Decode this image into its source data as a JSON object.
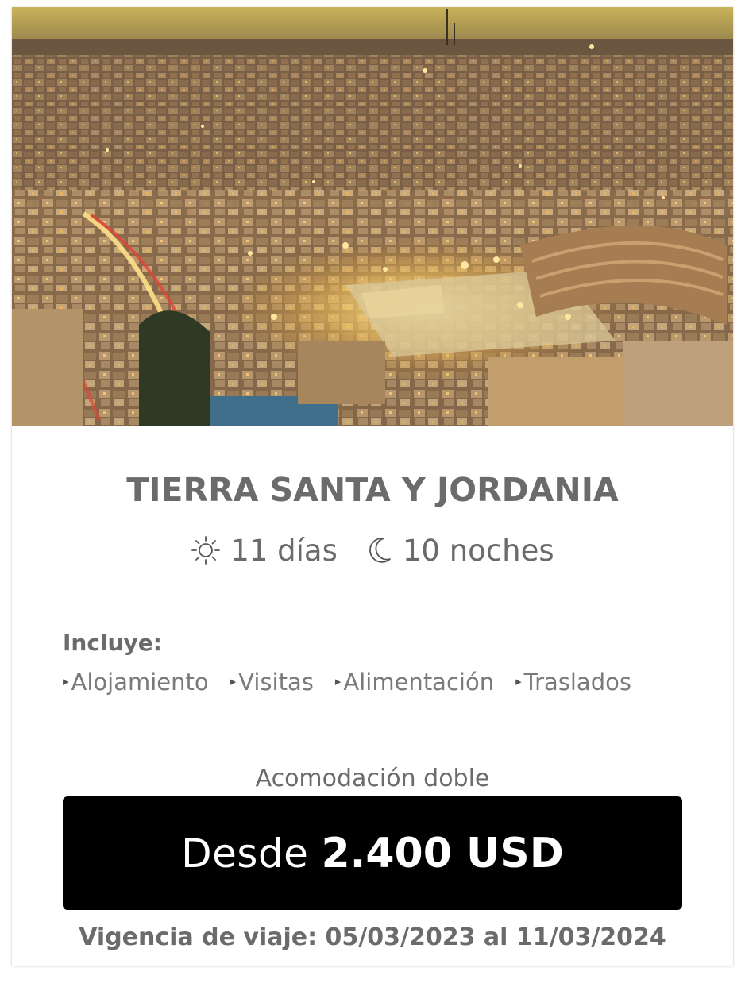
{
  "tour": {
    "image_alt": "Vista nocturna de Amán con el teatro romano",
    "title": "TIERRA SANTA Y JORDANIA",
    "days": "11 días",
    "nights": "10 noches",
    "days_icon": "sun-icon",
    "nights_icon": "moon-icon"
  },
  "includes": {
    "label": "Incluye:",
    "bullet": "▸",
    "items": [
      "Alojamiento",
      "Visitas",
      "Alimentación",
      "Traslados"
    ]
  },
  "pricing": {
    "accommodation": "Acomodación doble",
    "prefix": "Desde",
    "amount": "2.400 USD"
  },
  "validity": "Vigencia de viaje: 05/03/2023 al 11/03/2024",
  "colors": {
    "text_gray": "#6b6b6b",
    "price_bg": "#000000",
    "price_text": "#ffffff"
  }
}
